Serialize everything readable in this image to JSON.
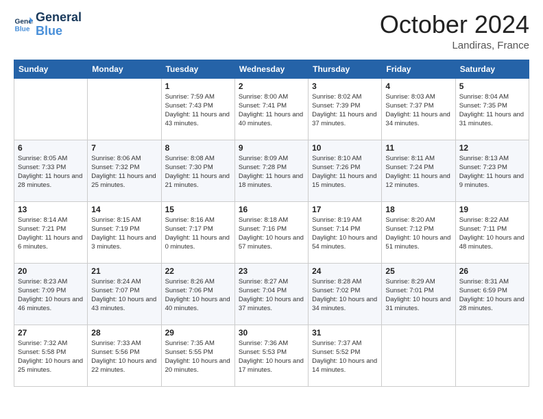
{
  "header": {
    "logo_line1": "General",
    "logo_line2": "Blue",
    "month": "October 2024",
    "location": "Landiras, France"
  },
  "days_of_week": [
    "Sunday",
    "Monday",
    "Tuesday",
    "Wednesday",
    "Thursday",
    "Friday",
    "Saturday"
  ],
  "weeks": [
    [
      {
        "day": "",
        "info": ""
      },
      {
        "day": "",
        "info": ""
      },
      {
        "day": "1",
        "info": "Sunrise: 7:59 AM\nSunset: 7:43 PM\nDaylight: 11 hours and 43 minutes."
      },
      {
        "day": "2",
        "info": "Sunrise: 8:00 AM\nSunset: 7:41 PM\nDaylight: 11 hours and 40 minutes."
      },
      {
        "day": "3",
        "info": "Sunrise: 8:02 AM\nSunset: 7:39 PM\nDaylight: 11 hours and 37 minutes."
      },
      {
        "day": "4",
        "info": "Sunrise: 8:03 AM\nSunset: 7:37 PM\nDaylight: 11 hours and 34 minutes."
      },
      {
        "day": "5",
        "info": "Sunrise: 8:04 AM\nSunset: 7:35 PM\nDaylight: 11 hours and 31 minutes."
      }
    ],
    [
      {
        "day": "6",
        "info": "Sunrise: 8:05 AM\nSunset: 7:33 PM\nDaylight: 11 hours and 28 minutes."
      },
      {
        "day": "7",
        "info": "Sunrise: 8:06 AM\nSunset: 7:32 PM\nDaylight: 11 hours and 25 minutes."
      },
      {
        "day": "8",
        "info": "Sunrise: 8:08 AM\nSunset: 7:30 PM\nDaylight: 11 hours and 21 minutes."
      },
      {
        "day": "9",
        "info": "Sunrise: 8:09 AM\nSunset: 7:28 PM\nDaylight: 11 hours and 18 minutes."
      },
      {
        "day": "10",
        "info": "Sunrise: 8:10 AM\nSunset: 7:26 PM\nDaylight: 11 hours and 15 minutes."
      },
      {
        "day": "11",
        "info": "Sunrise: 8:11 AM\nSunset: 7:24 PM\nDaylight: 11 hours and 12 minutes."
      },
      {
        "day": "12",
        "info": "Sunrise: 8:13 AM\nSunset: 7:23 PM\nDaylight: 11 hours and 9 minutes."
      }
    ],
    [
      {
        "day": "13",
        "info": "Sunrise: 8:14 AM\nSunset: 7:21 PM\nDaylight: 11 hours and 6 minutes."
      },
      {
        "day": "14",
        "info": "Sunrise: 8:15 AM\nSunset: 7:19 PM\nDaylight: 11 hours and 3 minutes."
      },
      {
        "day": "15",
        "info": "Sunrise: 8:16 AM\nSunset: 7:17 PM\nDaylight: 11 hours and 0 minutes."
      },
      {
        "day": "16",
        "info": "Sunrise: 8:18 AM\nSunset: 7:16 PM\nDaylight: 10 hours and 57 minutes."
      },
      {
        "day": "17",
        "info": "Sunrise: 8:19 AM\nSunset: 7:14 PM\nDaylight: 10 hours and 54 minutes."
      },
      {
        "day": "18",
        "info": "Sunrise: 8:20 AM\nSunset: 7:12 PM\nDaylight: 10 hours and 51 minutes."
      },
      {
        "day": "19",
        "info": "Sunrise: 8:22 AM\nSunset: 7:11 PM\nDaylight: 10 hours and 48 minutes."
      }
    ],
    [
      {
        "day": "20",
        "info": "Sunrise: 8:23 AM\nSunset: 7:09 PM\nDaylight: 10 hours and 46 minutes."
      },
      {
        "day": "21",
        "info": "Sunrise: 8:24 AM\nSunset: 7:07 PM\nDaylight: 10 hours and 43 minutes."
      },
      {
        "day": "22",
        "info": "Sunrise: 8:26 AM\nSunset: 7:06 PM\nDaylight: 10 hours and 40 minutes."
      },
      {
        "day": "23",
        "info": "Sunrise: 8:27 AM\nSunset: 7:04 PM\nDaylight: 10 hours and 37 minutes."
      },
      {
        "day": "24",
        "info": "Sunrise: 8:28 AM\nSunset: 7:02 PM\nDaylight: 10 hours and 34 minutes."
      },
      {
        "day": "25",
        "info": "Sunrise: 8:29 AM\nSunset: 7:01 PM\nDaylight: 10 hours and 31 minutes."
      },
      {
        "day": "26",
        "info": "Sunrise: 8:31 AM\nSunset: 6:59 PM\nDaylight: 10 hours and 28 minutes."
      }
    ],
    [
      {
        "day": "27",
        "info": "Sunrise: 7:32 AM\nSunset: 5:58 PM\nDaylight: 10 hours and 25 minutes."
      },
      {
        "day": "28",
        "info": "Sunrise: 7:33 AM\nSunset: 5:56 PM\nDaylight: 10 hours and 22 minutes."
      },
      {
        "day": "29",
        "info": "Sunrise: 7:35 AM\nSunset: 5:55 PM\nDaylight: 10 hours and 20 minutes."
      },
      {
        "day": "30",
        "info": "Sunrise: 7:36 AM\nSunset: 5:53 PM\nDaylight: 10 hours and 17 minutes."
      },
      {
        "day": "31",
        "info": "Sunrise: 7:37 AM\nSunset: 5:52 PM\nDaylight: 10 hours and 14 minutes."
      },
      {
        "day": "",
        "info": ""
      },
      {
        "day": "",
        "info": ""
      }
    ]
  ]
}
